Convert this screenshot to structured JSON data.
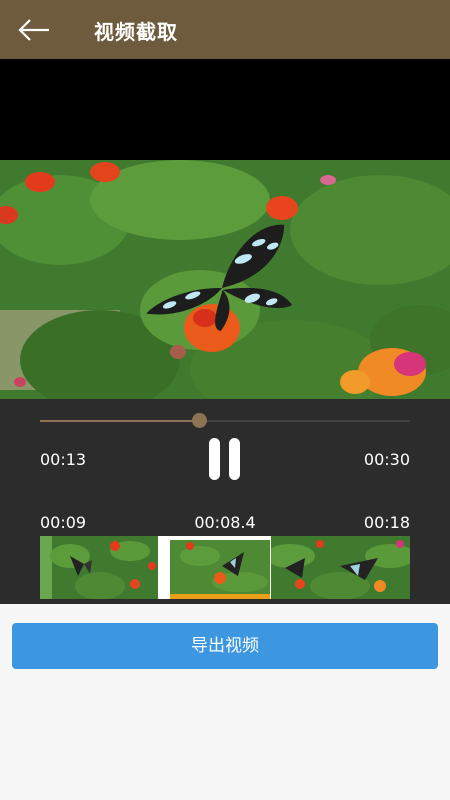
{
  "header": {
    "title": "视频截取",
    "back_icon": "arrow-left-icon"
  },
  "player": {
    "current_time": "00:13",
    "total_time": "00:30",
    "progress": 0.43,
    "state_icon": "pause-icon"
  },
  "clip": {
    "start_time": "00:09",
    "duration": "00:08.4",
    "end_time": "00:18"
  },
  "actions": {
    "export_label": "导出视频"
  },
  "colors": {
    "header": "#6e5a3d",
    "accent": "#8c7354",
    "button": "#3d96e0",
    "selection_border": "#ffffff",
    "selection_bottom": "#e8a017"
  }
}
